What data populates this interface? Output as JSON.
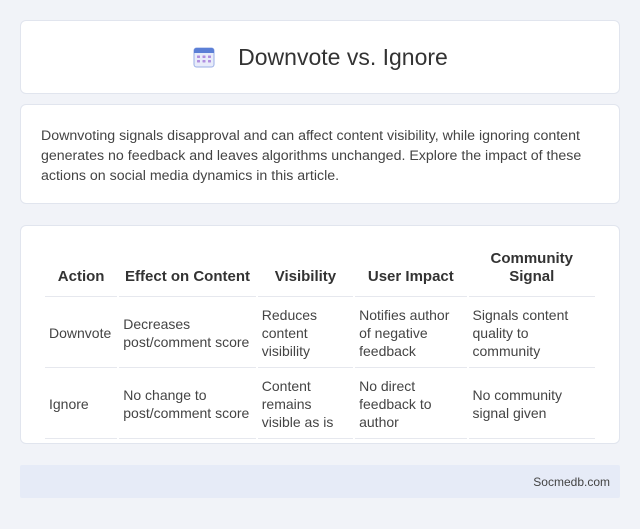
{
  "header": {
    "icon": "calendar-icon",
    "title": "Downvote vs. Ignore"
  },
  "intro": {
    "text": "Downvoting signals disapproval and can affect content visibility, while ignoring content generates no feedback and leaves algorithms unchanged. Explore the impact of these actions on social media dynamics in this article."
  },
  "table": {
    "headers": [
      "Action",
      "Effect on Content",
      "Visibility",
      "User Impact",
      "Community Signal"
    ],
    "rows": [
      [
        "Downvote",
        "Decreases post/comment score",
        "Reduces content visibility",
        "Notifies author of negative feedback",
        "Signals content quality to community"
      ],
      [
        "Ignore",
        "No change to post/comment score",
        "Content remains visible as is",
        "No direct feedback to author",
        "No community signal given"
      ]
    ]
  },
  "footer": {
    "text": "Socmedb.com"
  },
  "colors": {
    "background": "#f1f3f8",
    "card": "#ffffff",
    "footer_bg": "#e6ebf7",
    "icon_accent": "#5b7fd6"
  }
}
